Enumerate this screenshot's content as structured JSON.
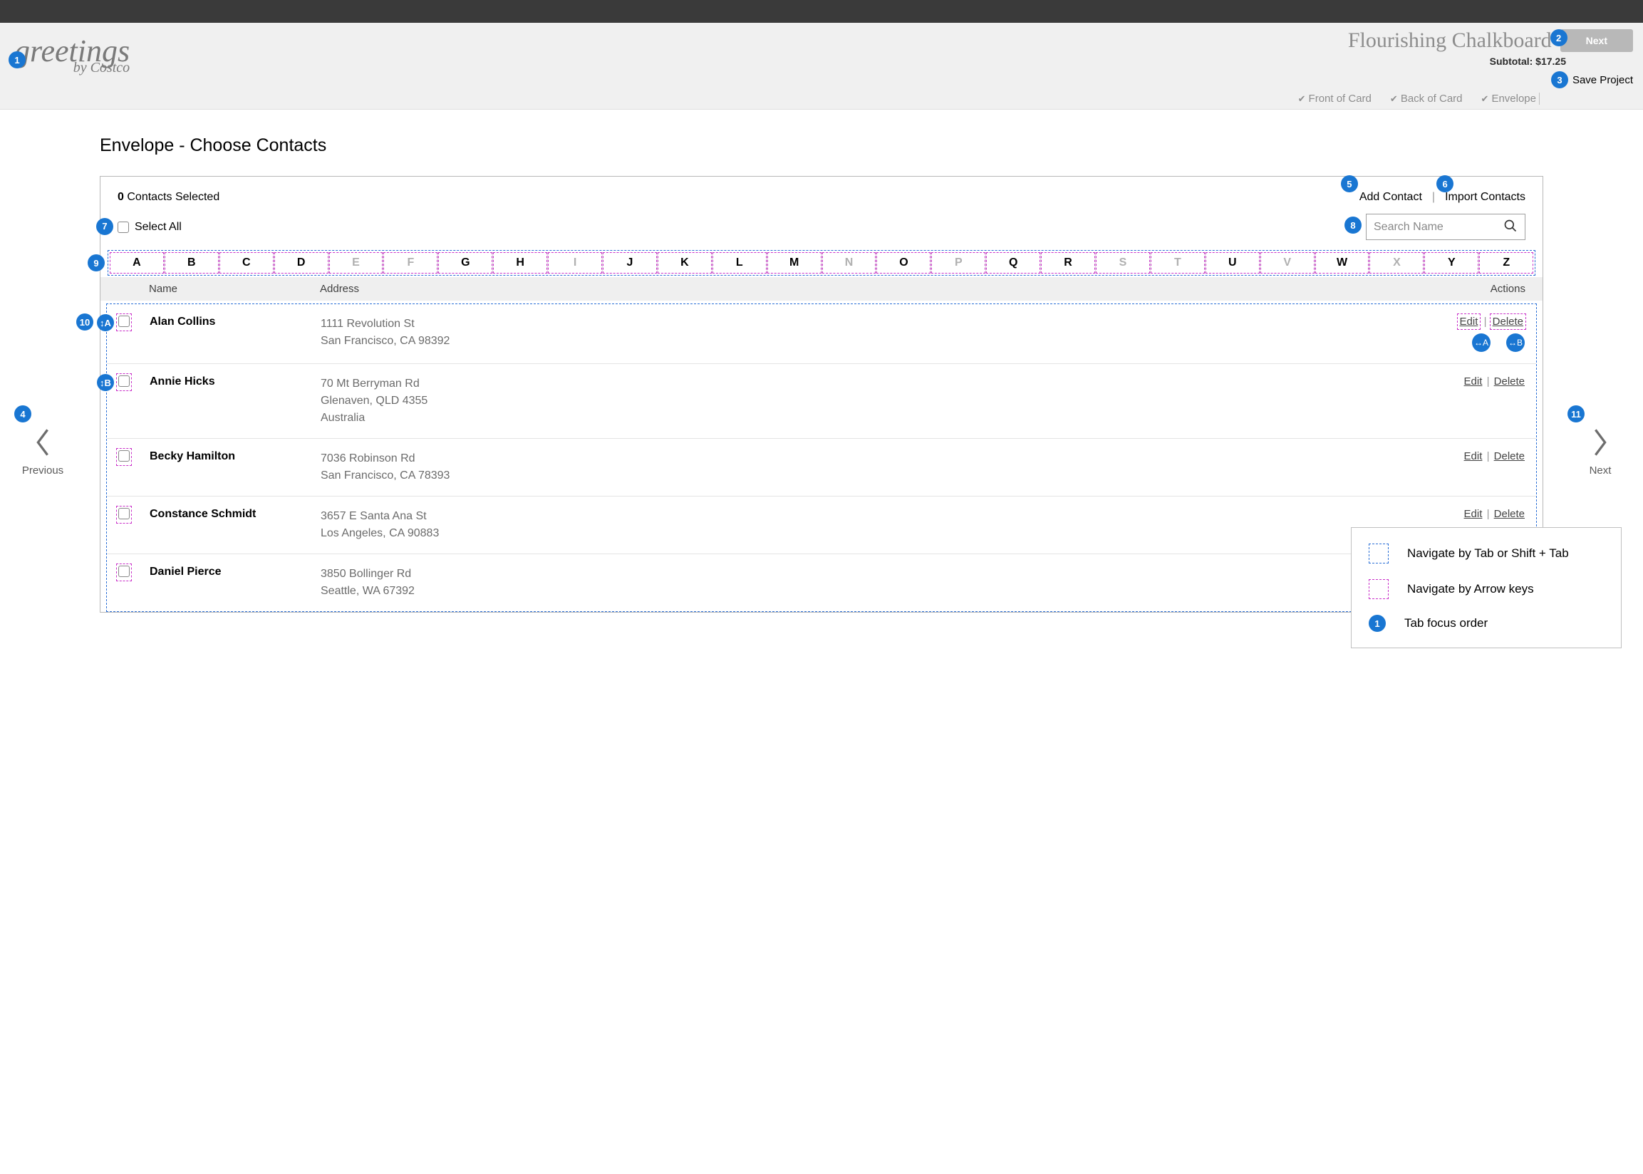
{
  "header": {
    "logo_text": "greetings",
    "logo_sub": "by Costco",
    "product_title": "Flourishing Chalkboard",
    "next_btn": "Next",
    "subtotal_label": "Subtotal:",
    "subtotal_value": "$17.25",
    "save_project": "Save Project",
    "progress": [
      {
        "label": "Front of Card"
      },
      {
        "label": "Back of Card"
      },
      {
        "label": "Envelope"
      }
    ]
  },
  "page": {
    "title": "Envelope - Choose Contacts"
  },
  "panel": {
    "selected_count": "0",
    "selected_label": "Contacts Selected",
    "add_contact": "Add Contact",
    "import_contacts": "Import Contacts",
    "select_all": "Select All",
    "search_placeholder": "Search Name",
    "alphabet": [
      {
        "l": "A",
        "enabled": true
      },
      {
        "l": "B",
        "enabled": true
      },
      {
        "l": "C",
        "enabled": true
      },
      {
        "l": "D",
        "enabled": true
      },
      {
        "l": "E",
        "enabled": false
      },
      {
        "l": "F",
        "enabled": false
      },
      {
        "l": "G",
        "enabled": true
      },
      {
        "l": "H",
        "enabled": true
      },
      {
        "l": "I",
        "enabled": false
      },
      {
        "l": "J",
        "enabled": true
      },
      {
        "l": "K",
        "enabled": true
      },
      {
        "l": "L",
        "enabled": true
      },
      {
        "l": "M",
        "enabled": true
      },
      {
        "l": "N",
        "enabled": false
      },
      {
        "l": "O",
        "enabled": true
      },
      {
        "l": "P",
        "enabled": false
      },
      {
        "l": "Q",
        "enabled": true
      },
      {
        "l": "R",
        "enabled": true
      },
      {
        "l": "S",
        "enabled": false
      },
      {
        "l": "T",
        "enabled": false
      },
      {
        "l": "U",
        "enabled": true
      },
      {
        "l": "V",
        "enabled": false
      },
      {
        "l": "W",
        "enabled": true
      },
      {
        "l": "X",
        "enabled": false
      },
      {
        "l": "Y",
        "enabled": true
      },
      {
        "l": "Z",
        "enabled": true
      }
    ],
    "columns": {
      "name": "Name",
      "address": "Address",
      "actions": "Actions"
    },
    "edit_label": "Edit",
    "delete_label": "Delete",
    "contacts": [
      {
        "name": "Alan Collins",
        "addr": [
          "1111 Revolution St",
          "San Francisco, CA 98392"
        ]
      },
      {
        "name": "Annie Hicks",
        "addr": [
          "70 Mt Berryman Rd",
          "Glenaven, QLD 4355",
          "Australia"
        ]
      },
      {
        "name": "Becky Hamilton",
        "addr": [
          "7036 Robinson Rd",
          "San Francisco, CA 78393"
        ]
      },
      {
        "name": "Constance Schmidt",
        "addr": [
          "3657 E Santa Ana St",
          "Los Angeles, CA 90883"
        ]
      },
      {
        "name": "Daniel Pierce",
        "addr": [
          "3850 Bollinger Rd",
          "Seattle, WA 67392"
        ]
      }
    ]
  },
  "sidenav": {
    "prev": "Previous",
    "next": "Next"
  },
  "badges": {
    "b1": "1",
    "b2": "2",
    "b3": "3",
    "b4": "4",
    "b5": "5",
    "b6": "6",
    "b7": "7",
    "b8": "8",
    "b9": "9",
    "b10": "10",
    "b11": "11",
    "vA": "↕A",
    "vB": "↕B",
    "hA": "↔A",
    "hB": "↔B"
  },
  "legend": {
    "tab": "Navigate by Tab or Shift + Tab",
    "arrow": "Navigate by Arrow keys",
    "order": "Tab focus order",
    "order_badge": "1"
  }
}
